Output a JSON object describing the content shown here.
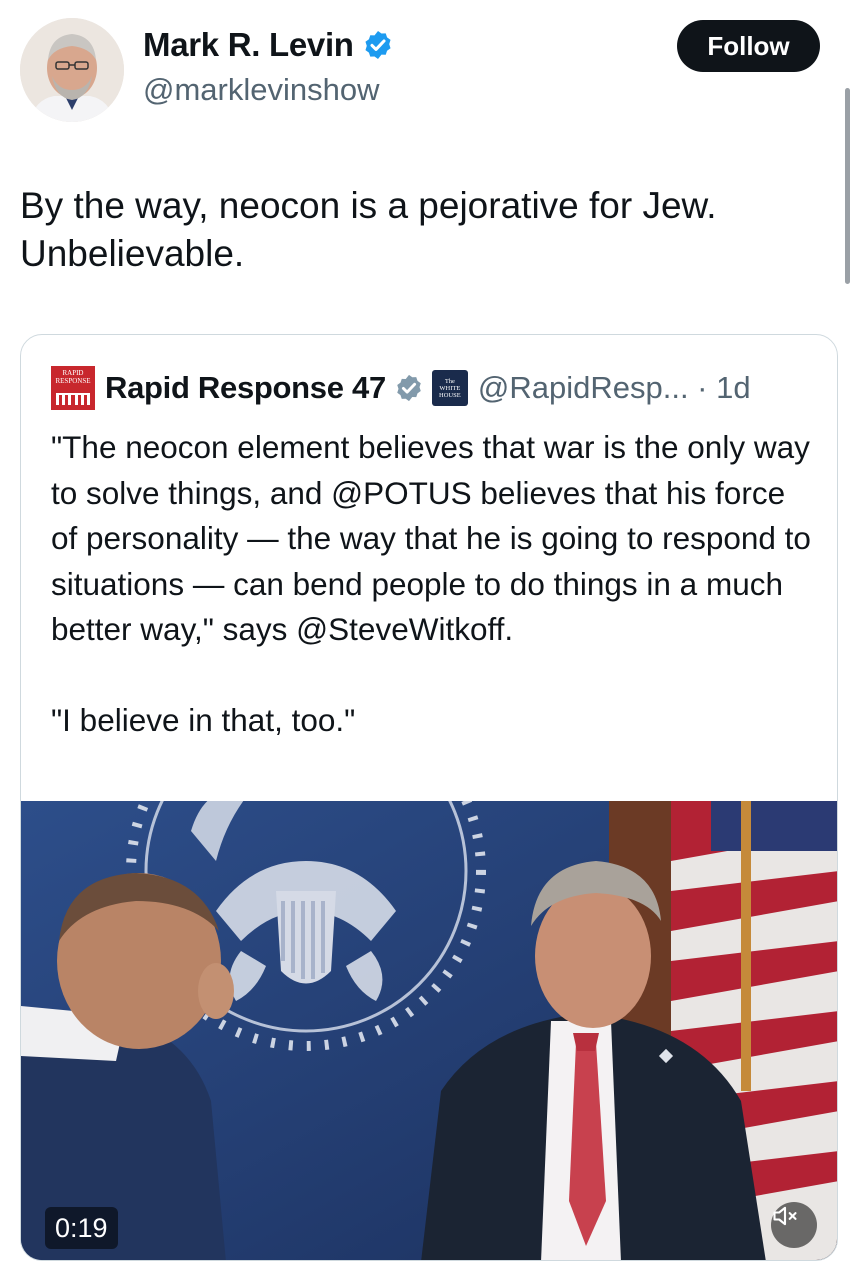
{
  "author": {
    "display_name": "Mark R. Levin",
    "handle": "@marklevinshow",
    "verified_color": "#1d9bf0"
  },
  "follow_label": "Follow",
  "tweet": {
    "lines": [
      "By the way, neocon is a pejorative for Jew.",
      "Unbelievable."
    ]
  },
  "quote": {
    "logo_text": [
      "RAPID",
      "RESPONSE"
    ],
    "display_name": "Rapid Response 47",
    "verified_color": "#829aab",
    "affiliate_badge_text": [
      "The",
      "WHITE",
      "HOUSE"
    ],
    "handle_time": "@RapidResp... · 1d",
    "paragraphs": [
      "\"The neocon element believes that war is the only way to solve things, and @POTUS believes that his force of personality — the way that he is going to respond to situations — can bend people to do things in a much better way,\" says @SteveWitkoff.",
      "\"I believe in that, too.\""
    ],
    "video": {
      "duration": "0:19",
      "mute_icon": "speaker-muted-icon"
    }
  }
}
